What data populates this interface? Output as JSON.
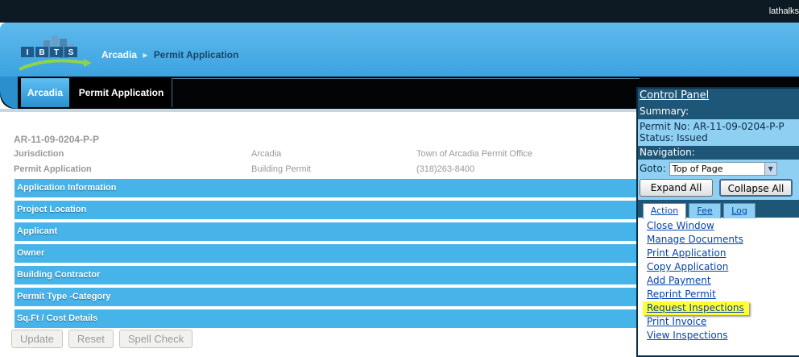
{
  "topbar": {
    "user": "lathalks"
  },
  "header": {
    "logo_letters": [
      "I",
      "B",
      "T",
      "S"
    ],
    "breadcrumb": {
      "root": "Arcadia",
      "separator": "▸",
      "current": "Permit Application"
    }
  },
  "tabs": [
    {
      "label": "Arcadia",
      "active": true
    },
    {
      "label": "Permit Application",
      "active": false
    }
  ],
  "permit": {
    "number": "AR-11-09-0204-P-P",
    "rows": [
      {
        "label": "Jurisdiction",
        "value1": "Arcadia",
        "value2": "Town of Arcadia Permit Office"
      },
      {
        "label": "Permit Application",
        "value1": "Building Permit",
        "value2": "(318)263-8400"
      }
    ]
  },
  "sections": [
    "Application Information",
    "Project Location",
    "Applicant",
    "Owner",
    "Building Contractor",
    "Permit Type -Category",
    "Sq.Ft / Cost Details"
  ],
  "buttons": {
    "update": "Update",
    "reset": "Reset",
    "spell_check": "Spell Check"
  },
  "control_panel": {
    "title": "Control Panel",
    "summary_heading": "Summary:",
    "permit_line": "Permit No: AR-11-09-0204-P-P",
    "status_line": "Status: Issued",
    "navigation_heading": "Navigation:",
    "goto_label": "Goto:",
    "goto_value": "Top of Page",
    "expand_all": "Expand All",
    "collapse_all": "Collapse All",
    "tabs": [
      "Action",
      "Fee",
      "Log"
    ],
    "links": [
      "Close Window",
      "Manage Documents",
      "Print Application",
      "Copy Application",
      "Add Payment",
      "Reprint Permit",
      "Request Inspections",
      "Print Invoice",
      "View Inspections"
    ],
    "highlight_color": "#ffff33"
  }
}
